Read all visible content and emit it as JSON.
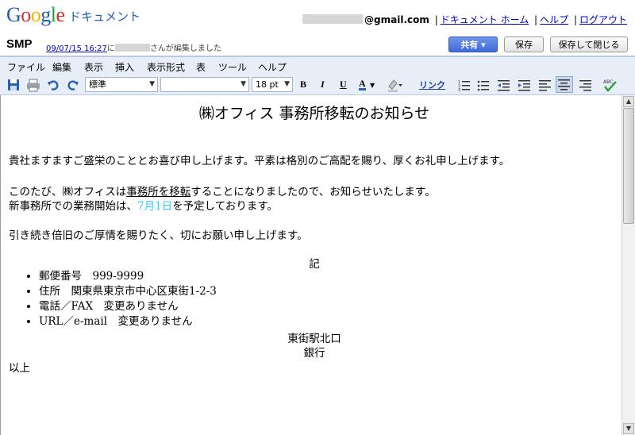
{
  "app": {
    "logo_letters": [
      "G",
      "o",
      "o",
      "g",
      "l",
      "e"
    ],
    "logo_colors": [
      "#1a5dbe",
      "#d3312b",
      "#f2b300",
      "#1a5dbe",
      "#23a340",
      "#d3312b"
    ],
    "product": "ドキュメント"
  },
  "account": {
    "email_domain": "@gmail.com",
    "links": [
      "ドキュメント ホーム",
      "ヘルプ",
      "ログアウト"
    ],
    "separator": "|"
  },
  "document": {
    "name": "SMP",
    "edited_timestamp": "09/07/15 16:27",
    "edited_prefix": "に",
    "edited_suffix": "さんが編集しました"
  },
  "buttons": {
    "share": "共有 ▾",
    "save": "保存",
    "save_close": "保存して閉じる"
  },
  "menu": [
    "ファイル",
    "編集",
    "表示",
    "挿入",
    "表示形式",
    "表",
    "ツール",
    "ヘルプ"
  ],
  "toolbar": {
    "style": "標準",
    "font": "",
    "size": "18 pt",
    "bold": "B",
    "italic": "I",
    "underline": "U",
    "text_color": "A",
    "link": "リンク",
    "spellcheck": "ABC"
  },
  "content": {
    "title": "㈱オフィス 事務所移転のお知らせ",
    "p1": "貴社ますますご盛栄のこととお喜び申し上げます。平素は格別のご高配を賜り、厚くお礼申し上げます。",
    "p2_pre": "このたび、㈱オフィスは",
    "p2_underlined": "事務所を移転",
    "p2_post": "することになりましたので、お知らせいたします。",
    "p3_pre": "新事務所での業務開始は、",
    "p3_highlight": "7月1日",
    "p3_post": "を予定しております。",
    "p4": "引き続き倍旧のご厚情を賜りたく、切にお願い申し上げます。",
    "ki": "記",
    "bullets": [
      "郵便番号　999-9999",
      "住所　関東県東京市中心区東街1-2-3",
      "電話／FAX　変更ありません",
      "URL／e-mail　変更ありません"
    ],
    "center1": "東街駅北口",
    "center2": "銀行",
    "closing": "以上"
  },
  "colors": {
    "accent_link": "#0000cc",
    "highlight_cyan": "#33ccff",
    "share_blue": "#3f6bd8",
    "toolbar_bg": "#e8eef7"
  }
}
